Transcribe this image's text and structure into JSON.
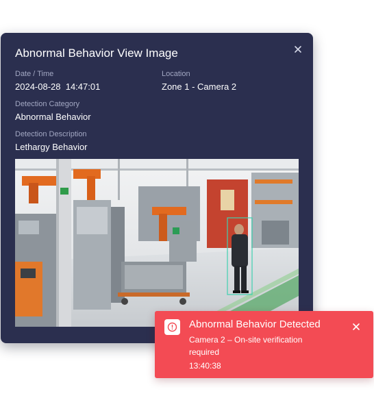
{
  "dialog": {
    "title": "Abnormal Behavior View Image",
    "fields": {
      "datetime": {
        "label": "Date / Time",
        "value": "2024-08-28  14:47:01"
      },
      "location": {
        "label": "Location",
        "value": "Zone 1 - Camera 2"
      },
      "category": {
        "label": "Detection Category",
        "value": "Abnormal Behavior"
      },
      "description": {
        "label": "Detection Description",
        "value": "Lethargy Behavior"
      }
    },
    "close_icon": "close-icon",
    "image": {
      "subject": "factory-floor-camera-frame",
      "detection_box_color": "#3fd0b0"
    }
  },
  "alert": {
    "title": "Abnormal Behavior Detected",
    "message": "Camera 2 – On-site verification required",
    "time": "13:40:38",
    "icon": "alert-circle-icon",
    "close_icon": "close-icon"
  },
  "colors": {
    "dialog_bg": "#2b2f4f",
    "label": "#a3a8c3",
    "alert_bg": "#f34b54"
  }
}
